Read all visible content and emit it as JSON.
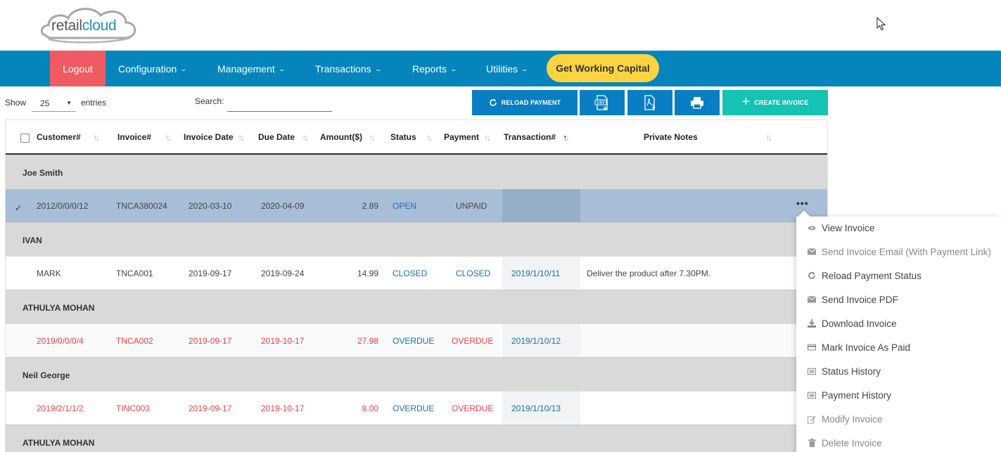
{
  "brand": {
    "name_part1": "retail",
    "name_part2": "cloud"
  },
  "navbar": {
    "logout": "Logout",
    "items": [
      "Configuration",
      "Management",
      "Transactions",
      "Reports",
      "Utilities"
    ],
    "capital": "Get Working Capital"
  },
  "controls": {
    "show_label": "Show",
    "entries_value": "25",
    "entries_label": "entries",
    "search_label": "Search:",
    "search_value": ""
  },
  "toolbar": {
    "reload_payment": "RELOAD PAYMENT",
    "csv": "CSV",
    "create_invoice": "CREATE INVOICE"
  },
  "table": {
    "headers": [
      "Customer#",
      "Invoice#",
      "Invoice Date",
      "Due Date",
      "Amount($)",
      "Status",
      "Payment",
      "Transaction#",
      "Private Notes"
    ],
    "groups": [
      {
        "name": "Joe Smith"
      },
      {
        "name": "IVAN"
      },
      {
        "name": "ATHULYA MOHAN"
      },
      {
        "name": "Neil George"
      },
      {
        "name": "ATHULYA MOHAN"
      }
    ],
    "rows": [
      {
        "customer": "2012/0/0/0/12",
        "invoice": "TNCA380024",
        "invoice_date": "2020-03-10",
        "due_date": "2020-04-09",
        "amount": "2.89",
        "status": "OPEN",
        "payment": "UNPAID",
        "transaction": "",
        "notes": ""
      },
      {
        "customer": "MARK",
        "invoice": "TNCA001",
        "invoice_date": "2019-09-17",
        "due_date": "2019-09-24",
        "amount": "14.99",
        "status": "CLOSED",
        "payment": "CLOSED",
        "transaction": "2019/1/10/11",
        "notes": "Deliver the product after 7.30PM."
      },
      {
        "customer": "2019/0/0/0/4",
        "invoice": "TNCA002",
        "invoice_date": "2019-09-17",
        "due_date": "2019-10-17",
        "amount": "27.98",
        "status": "OVERDUE",
        "payment": "OVERDUE",
        "transaction": "2019/1/10/12",
        "notes": ""
      },
      {
        "customer": "2019/2/1/1/2",
        "invoice": "TINC003",
        "invoice_date": "2019-09-17",
        "due_date": "2019-10-17",
        "amount": "8.00",
        "status": "OVERDUE",
        "payment": "OVERDUE",
        "transaction": "2019/1/10/13",
        "notes": ""
      }
    ],
    "selected_mark": "✓",
    "row_menu_glyph": "•••"
  },
  "context_menu": {
    "items": [
      {
        "label": "View Invoice",
        "icon": "eye-icon"
      },
      {
        "label": "Send Invoice Email (With Payment Link)",
        "icon": "envelope-icon"
      },
      {
        "label": "Reload Payment Status",
        "icon": "refresh-icon"
      },
      {
        "label": "Send Invoice PDF",
        "icon": "envelope-icon"
      },
      {
        "label": "Download Invoice",
        "icon": "download-icon"
      },
      {
        "label": "Mark Invoice As Paid",
        "icon": "credit-card-icon"
      },
      {
        "label": "Status History",
        "icon": "list-icon"
      },
      {
        "label": "Payment History",
        "icon": "list-icon"
      },
      {
        "label": "Modify Invoice",
        "icon": "edit-icon"
      },
      {
        "label": "Delete Invoice",
        "icon": "trash-icon"
      }
    ]
  },
  "colors": {
    "navbar": "#0585bc",
    "logout": "#ee5b62",
    "capital": "#fcd341",
    "create_button": "#15c3b2",
    "overdue_text": "#e2424b",
    "status_text": "#1a6fb0",
    "selected_row": "#a8bed7"
  }
}
